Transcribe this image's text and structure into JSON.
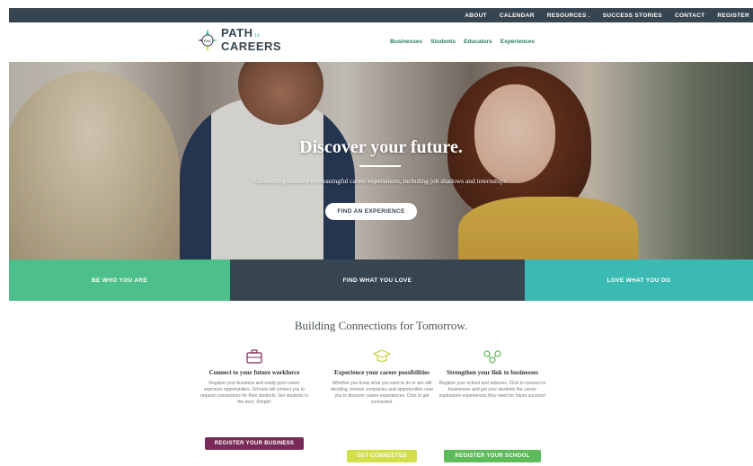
{
  "topnav": [
    "ABOUT",
    "CALENDAR",
    "RESOURCES .",
    "SUCCESS STORIES",
    "CONTACT",
    "REGISTER"
  ],
  "logo": {
    "line1": "PATH",
    "to": "to",
    "line2": "CAREERS",
    "badge": "P2C"
  },
  "mainnav": [
    "Businesses",
    "Students",
    "Educators",
    "Experiences"
  ],
  "hero": {
    "title": "Discover your future.",
    "subtitle": "Connecting students to meaningful career experiences, including job shadows and internships.",
    "button": "FIND AN EXPERIENCE"
  },
  "band": [
    "BE WHO YOU ARE",
    "FIND WHAT YOU LOVE",
    "LOVE WHAT YOU DO"
  ],
  "section": {
    "title": "Building Connections for Tomorrow.",
    "columns": [
      {
        "icon": "briefcase-icon",
        "title": "Connect to your future workforce",
        "text": "Register your business and easily post career exposure opportunities. Schools will contact you to request connections for their students. Get students in the door. Simple!",
        "button": "REGISTER YOUR BUSINESS",
        "color": "#7a2a58"
      },
      {
        "icon": "graduate-icon",
        "title": "Experience your career possibilities",
        "text": "Whether you know what you want to do or are still deciding, browse companies and opportunities near you to discover career experiences. Click to get connected.",
        "button": "GET CONNECTED",
        "color": "#d2de4a"
      },
      {
        "icon": "network-icon",
        "title": "Strengthen your link to businesses",
        "text": "Register your school and advisors. Click to connect to businesses and get your students the career exploration experiences they need for future success!",
        "button": "REGISTER YOUR SCHOOL",
        "color": "#5dbb5a"
      }
    ]
  }
}
